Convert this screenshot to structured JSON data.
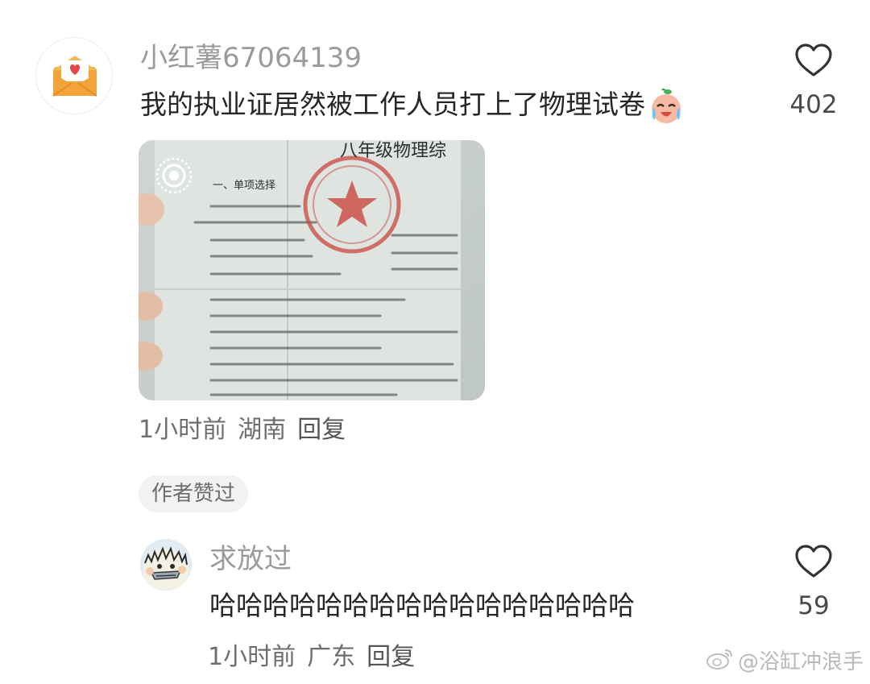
{
  "comments": [
    {
      "username": "小红薯67064139",
      "text": "我的执业证居然被工作人员打上了物理试卷",
      "emoji": "crying-laughing-emoji",
      "likes": "402",
      "time": "1小时前",
      "location": "湖南",
      "reply_label": "回复",
      "badge": "作者赞过",
      "image": {
        "header_text": "八年级物理综",
        "section_text": "一、单项选择",
        "stamp_color": "#c8473f"
      }
    },
    {
      "username": "求放过",
      "text": "哈哈哈哈哈哈哈哈哈哈哈哈哈哈哈哈",
      "likes": "59",
      "time": "1小时前",
      "location": "广东",
      "reply_label": "回复"
    }
  ],
  "watermark": "@浴缸冲浪手",
  "colors": {
    "username": "#9b9b9b",
    "content": "#262626",
    "meta": "#6e6e6e",
    "avatar_orange": "#f2a33a",
    "heart_red": "#e8454a"
  }
}
